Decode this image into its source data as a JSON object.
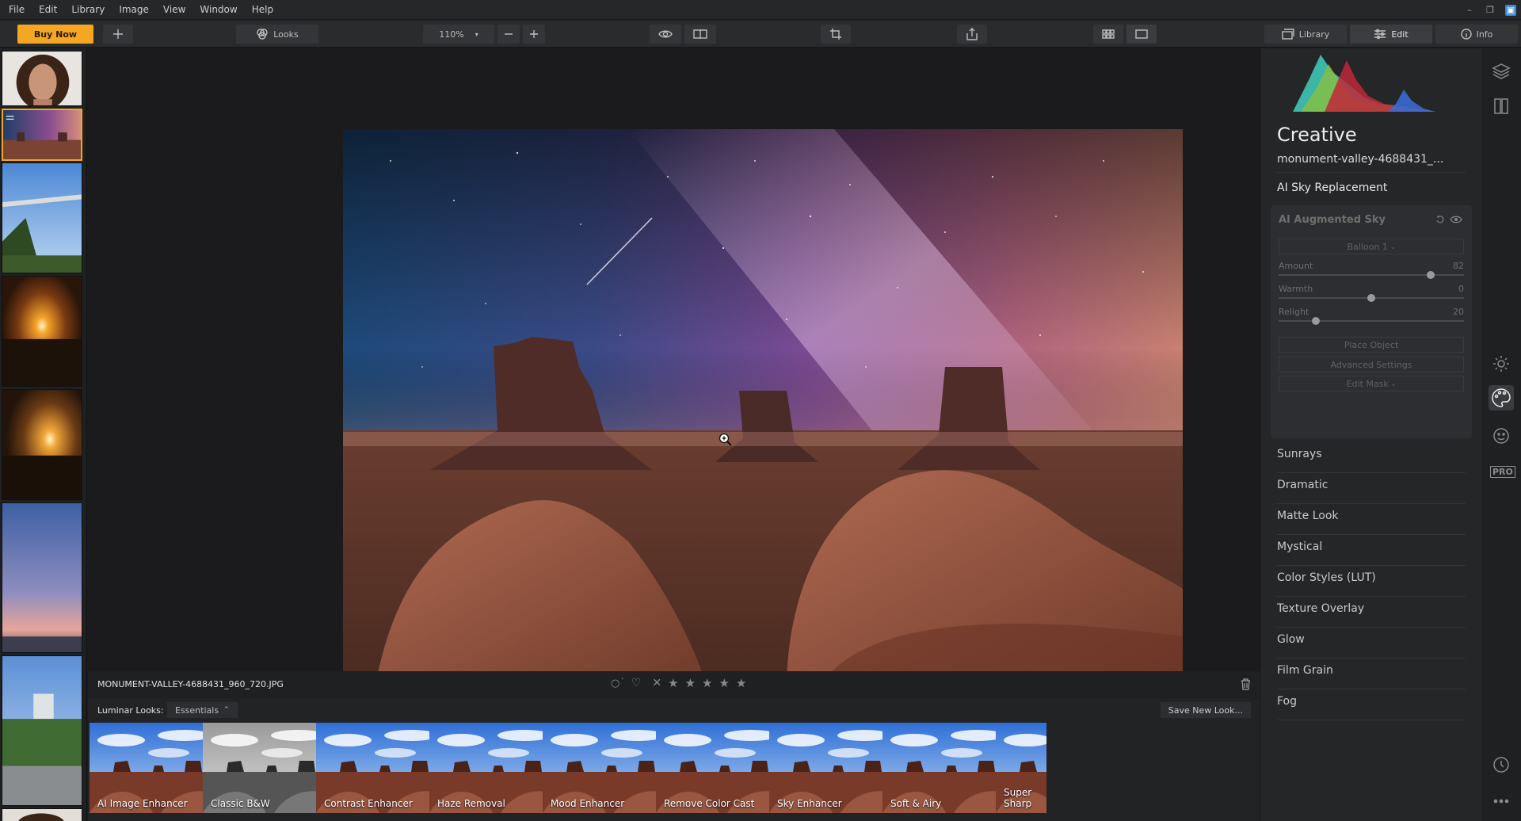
{
  "menu": [
    "File",
    "Edit",
    "Library",
    "Image",
    "View",
    "Window",
    "Help"
  ],
  "toolbar": {
    "buy_now": "Buy Now",
    "looks": "Looks",
    "zoom": "110%",
    "library": "Library",
    "edit": "Edit",
    "info": "Info"
  },
  "image_info": {
    "filename": "MONUMENT-VALLEY-4688431_960_720.JPG"
  },
  "looks": {
    "label": "Luminar Looks:",
    "collection": "Essentials",
    "save": "Save New Look...",
    "items": [
      "AI Image Enhancer",
      "Classic B&W",
      "Contrast Enhancer",
      "Haze Removal",
      "Mood Enhancer",
      "Remove Color Cast",
      "Sky Enhancer",
      "Soft & Airy",
      "Super Sharp"
    ]
  },
  "panel": {
    "title": "Creative",
    "filename": "monument-valley-4688431_...",
    "section": "AI Sky Replacement",
    "sky": {
      "title": "AI Augmented Sky",
      "preset": "Balloon 1",
      "amount_label": "Amount",
      "amount": "82",
      "warmth_label": "Warmth",
      "warmth": "0",
      "relight_label": "Relight",
      "relight": "20",
      "place_object": "Place Object",
      "advanced": "Advanced Settings",
      "edit_mask": "Edit Mask"
    },
    "filters": [
      "Sunrays",
      "Dramatic",
      "Matte Look",
      "Mystical",
      "Color Styles (LUT)",
      "Texture Overlay",
      "Glow",
      "Film Grain",
      "Fog"
    ]
  },
  "rail": {
    "pro": "PRO"
  }
}
